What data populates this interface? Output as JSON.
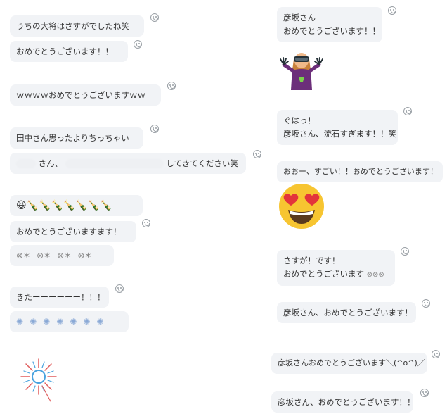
{
  "left": {
    "m1": "うちの大将はさすがでしたね笑",
    "m2": "おめでとうございます！！",
    "m3": "ｗｗｗｗおめでとうございますｗｗ",
    "m4": "田中さん思ったよりちっちゃい",
    "m5_a": "さん、",
    "m5_b": "してきてください笑",
    "m6_emoji": "😆🍾🍾🍾🍾🍾🍾🍾",
    "m7": "おめでとうございますます！",
    "m8_icons": [
      "cracker",
      "cracker",
      "cracker",
      "cracker"
    ],
    "m9": "きたーーーーーー！！！",
    "m10_icons": [
      "firework",
      "firework",
      "firework",
      "firework",
      "firework",
      "firework",
      "firework"
    ]
  },
  "right": {
    "r1_line1": "彦坂さん",
    "r1_line2": "おめでとうございます！！",
    "r2_line1": "ぐはっ！",
    "r2_line2": "彦坂さん、流石すぎます！！笑",
    "r3": "おおー、すごい！！おめでとうございます！",
    "r4_line1": "さすが！です！",
    "r4_line2": "おめでとうございます",
    "r5": "彦坂さん、おめでとうございます！",
    "r6": "彦坂さんおめでとうございます＼(^o^)／",
    "r7": "彦坂さん、おめでとうございます！！"
  },
  "colors": {
    "bubble": "#f1f3f6",
    "text": "#333333",
    "icon": "#9aa0a6"
  }
}
